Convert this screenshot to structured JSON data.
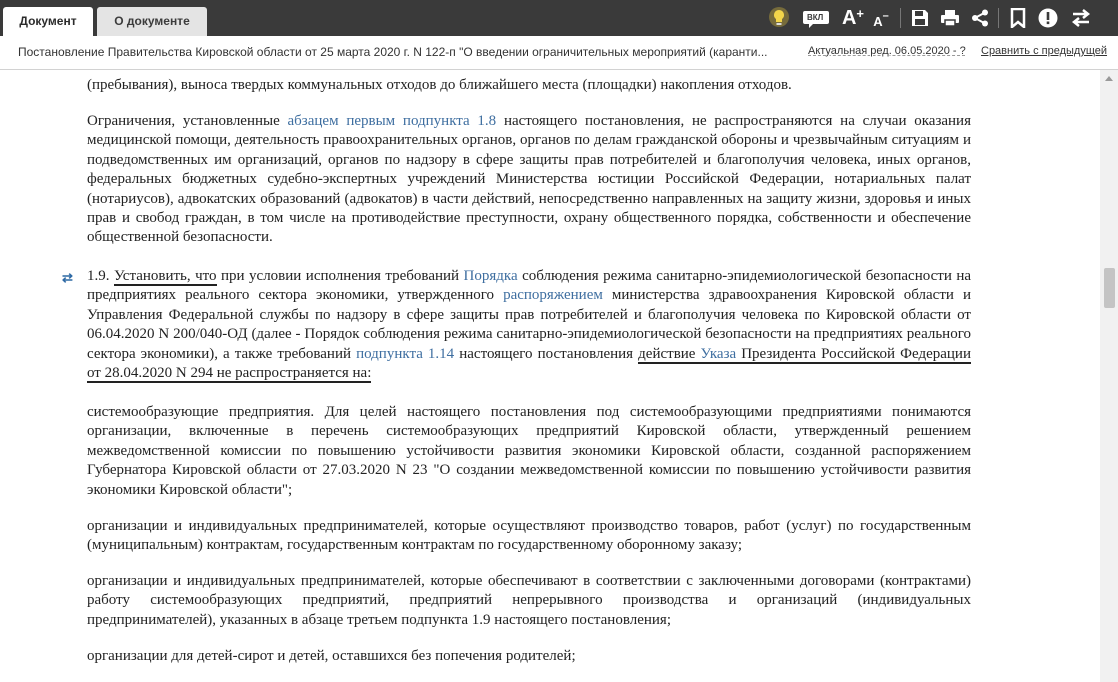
{
  "tabs": {
    "document": "Документ",
    "about": "О документе"
  },
  "toolbar": {
    "tip_icon": "lightbulb-icon",
    "vkl_label": "ВКЛ",
    "font_increase": "A",
    "font_decrease": "A"
  },
  "doc": {
    "title": "Постановление Правительства Кировской области от 25 марта 2020 г. N 122-п \"О введении ограничительных мероприятий (каранти...",
    "edition": "Актуальная ред. 06.05.2020 - ?",
    "compare": "Сравнить с предыдущей"
  },
  "content": {
    "p0": "(пребывания), выноса твердых коммунальных отходов до ближайшего места (площадки) накопления отходов.",
    "p1": {
      "a": "Ограничения, установленные ",
      "link": "абзацем первым подпункта 1.8",
      "b": " настоящего постановления, не распространяются на случаи оказания медицинской помощи, деятельность правоохранительных органов, органов по делам гражданской обороны и чрезвычайным ситуациям и подведомственных им организаций, органов по надзору в сфере защиты прав потребителей и благополучия человека, иных органов, федеральных бюджетных судебно-экспертных учреждений Министерства юстиции Российской Федерации, нотариальных палат (нотариусов), адвокатских образований (адвокатов) в части действий, непосредственно направленных на защиту жизни, здоровья и иных прав и свобод граждан, в том числе на противодействие преступности, охрану общественного порядка, собственности и обеспечение общественной безопасности."
    },
    "p2": {
      "num": "1.9. ",
      "u1": "Установить, что",
      "a": " при условии исполнения требований ",
      "link1": "Порядка",
      "b": " соблюдения режима санитарно-эпидемиологической безопасности на предприятиях реального сектора экономики, утвержденного ",
      "link2": "распоряжением",
      "c": " министерства здравоохранения Кировской области и Управления Федеральной службы по надзору в сфере защиты прав потребителей и благополучия человека по Кировской области от 06.04.2020 N 200/040-ОД (далее - Порядок соблюдения режима санитарно-эпидемиологической безопасности на предприятиях реального сектора экономики), а также требований ",
      "link3": "подпункта 1.14",
      "d": " настоящего постановления ",
      "u2a": "действие ",
      "u2link": "Указа",
      "u2b": " Президента Российской Федерации от 28.04.2020 N 294 не распространяется на:"
    },
    "p3": "системообразующие предприятия. Для целей настоящего постановления под системообразующими предприятиями понимаются организации, включенные в перечень системообразующих предприятий Кировской области, утвержденный решением межведомственной комиссии по повышению устойчивости развития экономики Кировской области, созданной распоряжением Губернатора Кировской области от 27.03.2020 N 23 \"О создании межведомственной комиссии по повышению устойчивости развития экономики Кировской области\";",
    "p4": "организации и индивидуальных предпринимателей, которые осуществляют производство товаров, работ (услуг) по государственным (муниципальным) контрактам, государственным контрактам по государственному оборонному заказу;",
    "p5": "организации и индивидуальных предпринимателей, которые обеспечивают в соответствии с заключенными договорами (контрактами) работу системообразующих предприятий, предприятий непрерывного производства и организаций (индивидуальных предпринимателей), указанных в абзаце третьем подпункта 1.9 настоящего постановления;",
    "p6": "организации для детей-сирот и детей, оставшихся без попечения родителей;"
  },
  "colors": {
    "topbar": "#3a3a3a",
    "link": "#3e6ea0",
    "lightbulb": "#e8c840",
    "marker": "#2f6aa5"
  }
}
